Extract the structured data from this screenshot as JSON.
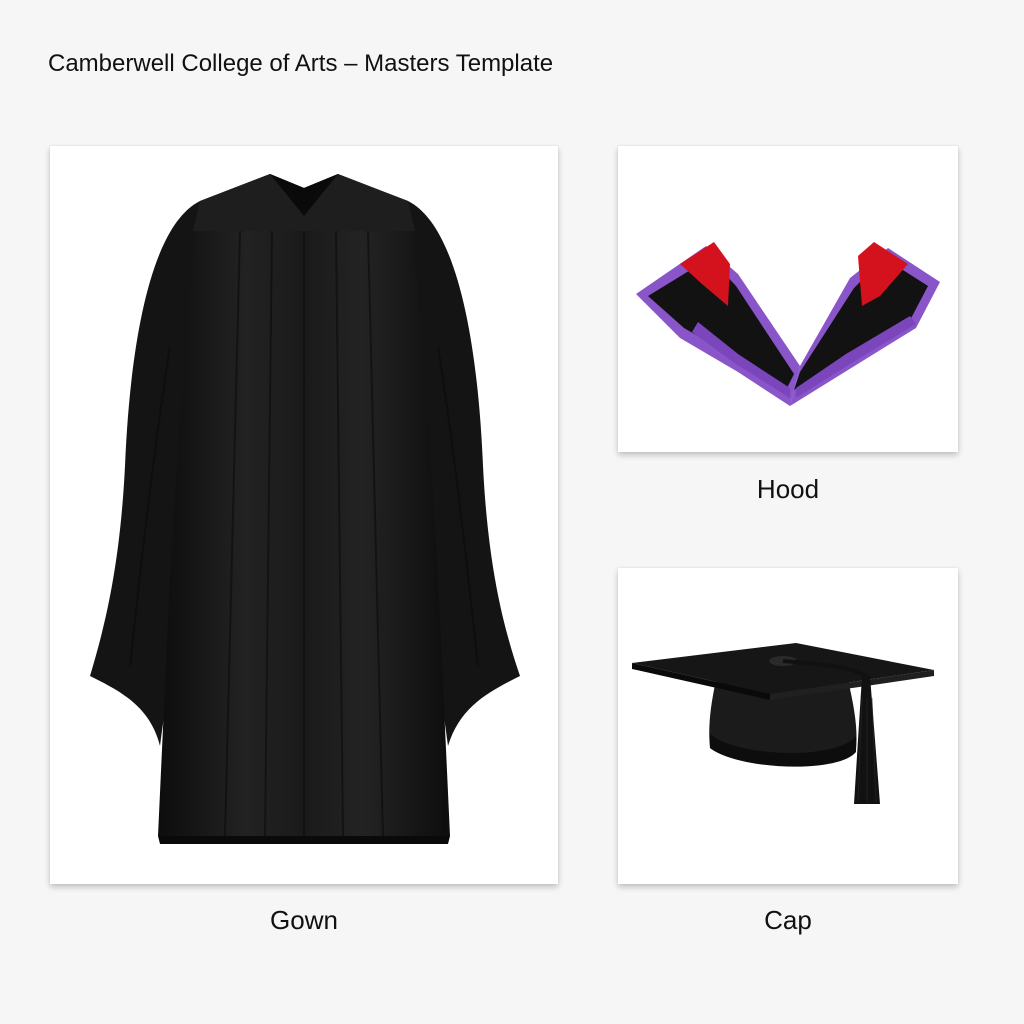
{
  "title": "Camberwell College of Arts – Masters Template",
  "items": [
    {
      "label": "Gown",
      "icon": "gown-image"
    },
    {
      "label": "Hood",
      "icon": "hood-image"
    },
    {
      "label": "Cap",
      "icon": "cap-image"
    }
  ],
  "colors": {
    "gown": "#1b1b1b",
    "hood_shell": "#121212",
    "hood_lining": "#8a55c9",
    "hood_accent": "#d4121e",
    "cap": "#161616"
  }
}
